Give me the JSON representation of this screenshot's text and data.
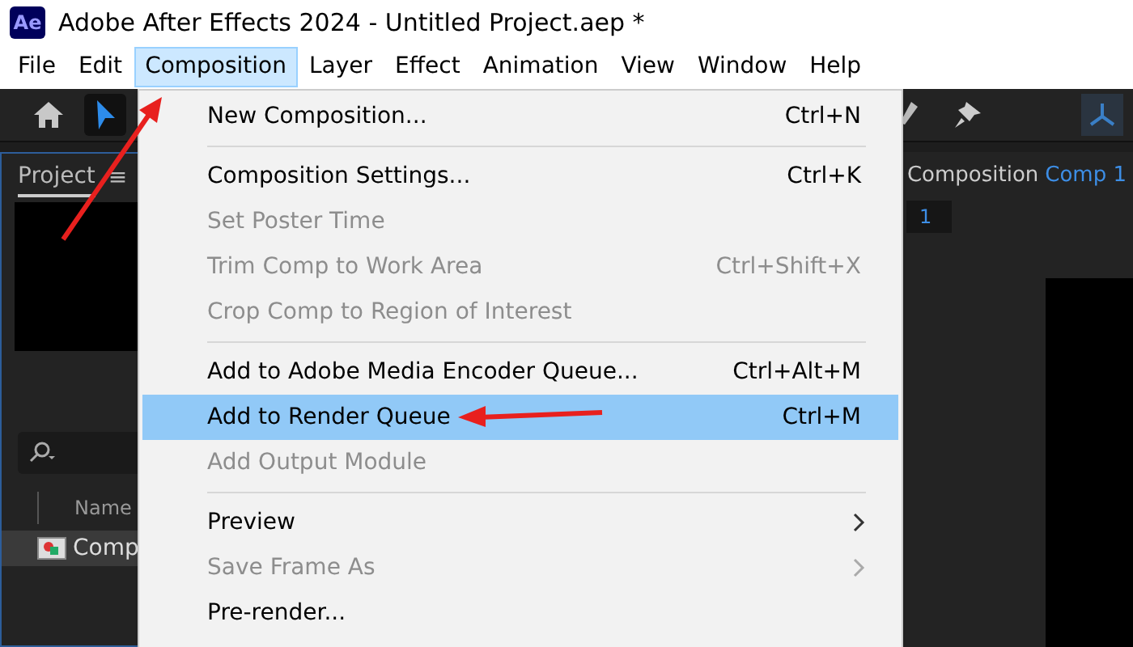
{
  "window": {
    "title": "Adobe After Effects 2024 - Untitled Project.aep *",
    "app_badge": "Ae"
  },
  "menubar": [
    {
      "label": "File",
      "selected": false
    },
    {
      "label": "Edit",
      "selected": false
    },
    {
      "label": "Composition",
      "selected": true
    },
    {
      "label": "Layer",
      "selected": false
    },
    {
      "label": "Effect",
      "selected": false
    },
    {
      "label": "Animation",
      "selected": false
    },
    {
      "label": "View",
      "selected": false
    },
    {
      "label": "Window",
      "selected": false
    },
    {
      "label": "Help",
      "selected": false
    }
  ],
  "project_panel": {
    "tab": "Project",
    "tab_menu": "≡",
    "column": "Name",
    "row": "Comp"
  },
  "composition_panel": {
    "label": "Composition",
    "comp_name": "Comp 1",
    "field_value": "1"
  },
  "menu": [
    {
      "kind": "item",
      "label": "New Composition...",
      "shortcut": "Ctrl+N",
      "disabled": false,
      "selected": false,
      "submenu": false
    },
    {
      "kind": "separator"
    },
    {
      "kind": "item",
      "label": "Composition Settings...",
      "shortcut": "Ctrl+K",
      "disabled": false,
      "selected": false,
      "submenu": false
    },
    {
      "kind": "item",
      "label": "Set Poster Time",
      "disabled": true,
      "selected": false,
      "submenu": false
    },
    {
      "kind": "item",
      "label": "Trim Comp to Work Area",
      "shortcut": "Ctrl+Shift+X",
      "disabled": true,
      "selected": false,
      "submenu": false
    },
    {
      "kind": "item",
      "label": "Crop Comp to Region of Interest",
      "disabled": true,
      "selected": false,
      "submenu": false
    },
    {
      "kind": "separator"
    },
    {
      "kind": "item",
      "label": "Add to Adobe Media Encoder Queue...",
      "shortcut": "Ctrl+Alt+M",
      "disabled": false,
      "selected": false,
      "submenu": false
    },
    {
      "kind": "item",
      "label": "Add to Render Queue",
      "shortcut": "Ctrl+M",
      "disabled": false,
      "selected": true,
      "submenu": false
    },
    {
      "kind": "item",
      "label": "Add Output Module",
      "disabled": true,
      "selected": false,
      "submenu": false
    },
    {
      "kind": "separator"
    },
    {
      "kind": "item",
      "label": "Preview",
      "disabled": false,
      "selected": false,
      "submenu": true
    },
    {
      "kind": "item",
      "label": "Save Frame As",
      "disabled": true,
      "selected": false,
      "submenu": true
    },
    {
      "kind": "item",
      "label": "Pre-render...",
      "disabled": false,
      "selected": false,
      "submenu": false
    }
  ]
}
